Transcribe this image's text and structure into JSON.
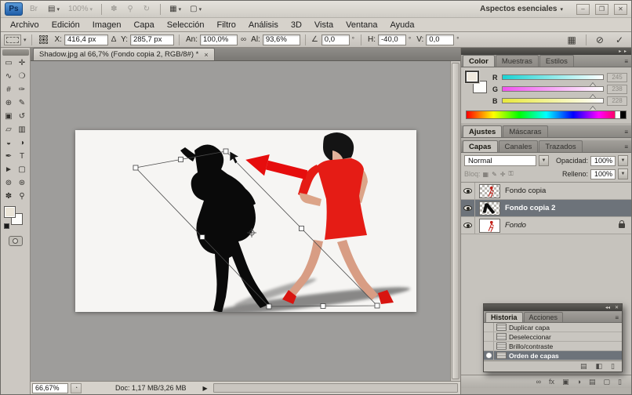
{
  "window": {
    "logo": "Ps",
    "workspace": "Aspectos esenciales",
    "workspace_dd": "▾",
    "controls": {
      "minimize": "–",
      "restore": "❐",
      "close": "✕"
    }
  },
  "titlebar": {
    "group1": [
      {
        "name": "launch-bridge-icon",
        "glyph": "Br",
        "dd": "",
        "disabled": true
      },
      {
        "name": "view-extras-icon",
        "glyph": "▤",
        "dd": "▾"
      },
      {
        "name": "zoom-level-dropdown",
        "glyph": "100%",
        "dd": "▾",
        "disabled": true
      }
    ],
    "group2": [
      {
        "name": "hand-tool-icon",
        "glyph": "✽",
        "dd": "",
        "disabled": true
      },
      {
        "name": "zoom-tool-icon",
        "glyph": "⚲",
        "dd": "",
        "disabled": true
      },
      {
        "name": "rotate-view-icon",
        "glyph": "↻",
        "dd": "",
        "disabled": true
      }
    ],
    "group3": [
      {
        "name": "arrange-documents-icon",
        "glyph": "▦",
        "dd": "▾"
      },
      {
        "name": "screen-mode-icon",
        "glyph": "▢",
        "dd": "▾"
      }
    ]
  },
  "menubar": {
    "items": [
      "Archivo",
      "Edición",
      "Imagen",
      "Capa",
      "Selección",
      "Filtro",
      "Análisis",
      "3D",
      "Vista",
      "Ventana",
      "Ayuda"
    ]
  },
  "options": {
    "x_label": "X:",
    "x_value": "416,4 px",
    "delta_icon": "∆",
    "y_label": "Y:",
    "y_value": "285,7 px",
    "w_label": "An:",
    "w_value": "100,0%",
    "link_icon": "∞",
    "h_label": "Al:",
    "h_value": "93,6%",
    "angle_icon": "∠",
    "angle_value": "0,0",
    "hskew_label": "H:",
    "hskew_value": "-40,0",
    "vskew_label": "V:",
    "vskew_value": "0,0",
    "degree": "°",
    "warp_icon": "▦",
    "cancel_icon": "⊘",
    "commit_icon": "✓"
  },
  "toolbox": {
    "tools": [
      {
        "name": "tool-rectangular-marquee",
        "glyph": "▭"
      },
      {
        "name": "tool-move",
        "glyph": "✛"
      },
      {
        "name": "tool-lasso",
        "glyph": "∿"
      },
      {
        "name": "tool-quick-selection",
        "glyph": "❍"
      },
      {
        "name": "tool-crop",
        "glyph": "#"
      },
      {
        "name": "tool-eyedropper",
        "glyph": "✑"
      },
      {
        "name": "tool-healing-brush",
        "glyph": "⊕"
      },
      {
        "name": "tool-brush",
        "glyph": "✎"
      },
      {
        "name": "tool-clone-stamp",
        "glyph": "▣"
      },
      {
        "name": "tool-history-brush",
        "glyph": "↺"
      },
      {
        "name": "tool-eraser",
        "glyph": "▱"
      },
      {
        "name": "tool-gradient",
        "glyph": "▥"
      },
      {
        "name": "tool-blur",
        "glyph": "◒"
      },
      {
        "name": "tool-dodge",
        "glyph": "◑"
      },
      {
        "name": "tool-pen",
        "glyph": "✒"
      },
      {
        "name": "tool-type",
        "glyph": "T"
      },
      {
        "name": "tool-path-selection",
        "glyph": "►"
      },
      {
        "name": "tool-shape",
        "glyph": "▢"
      },
      {
        "name": "tool-3d-rotate",
        "glyph": "⊚"
      },
      {
        "name": "tool-3d-orbit",
        "glyph": "⊛"
      },
      {
        "name": "tool-hand",
        "glyph": "✽"
      },
      {
        "name": "tool-zoom",
        "glyph": "⚲"
      }
    ]
  },
  "document": {
    "tab_title": "Shadow.jpg al 66,7% (Fondo copia 2, RGB/8#) *",
    "close_glyph": "×"
  },
  "statusbar": {
    "zoom": "66,67%",
    "mini_icon": "◔",
    "doc_info": "Doc: 1,17 MB/3,26 MB",
    "arrow": "▶"
  },
  "dock": {
    "collapse": "▸ ▸",
    "panel_menu": "≡"
  },
  "color_panel": {
    "tabs": [
      "Color",
      "Muestras",
      "Estilos"
    ],
    "channels": [
      {
        "label": "R",
        "value": "245"
      },
      {
        "label": "G",
        "value": "238"
      },
      {
        "label": "B",
        "value": "228"
      }
    ]
  },
  "adjust_bar": {
    "tabs": [
      "Ajustes",
      "Máscaras"
    ]
  },
  "layers_panel": {
    "tabs": [
      "Capas",
      "Canales",
      "Trazados"
    ],
    "blend_mode": "Normal",
    "opacity_label": "Opacidad:",
    "opacity_value": "100%",
    "lock_label": "Bloq:",
    "lock_icons": [
      {
        "name": "lock-transparency-icon",
        "glyph": "▦"
      },
      {
        "name": "lock-pixels-icon",
        "glyph": "✎"
      },
      {
        "name": "lock-position-icon",
        "glyph": "✛"
      },
      {
        "name": "lock-all-icon",
        "glyph": "⚿"
      }
    ],
    "fill_label": "Relleno:",
    "fill_value": "100%",
    "layers": [
      {
        "name": "Fondo copia"
      },
      {
        "name": "Fondo copia 2"
      },
      {
        "name": "Fondo"
      }
    ],
    "footer_icons": [
      {
        "name": "link-layers-icon",
        "glyph": "∞"
      },
      {
        "name": "layer-style-icon",
        "glyph": "fx"
      },
      {
        "name": "add-mask-icon",
        "glyph": "▣"
      },
      {
        "name": "adjustment-layer-icon",
        "glyph": "◑"
      },
      {
        "name": "group-layers-icon",
        "glyph": "▤"
      },
      {
        "name": "new-layer-icon",
        "glyph": "▢"
      },
      {
        "name": "delete-layer-icon",
        "glyph": "▯"
      }
    ]
  },
  "history_panel": {
    "tabs": [
      "Historia",
      "Acciones"
    ],
    "header_icons": [
      {
        "name": "collapse-icons",
        "glyph": "◂◂"
      },
      {
        "name": "close-icon",
        "glyph": "✕"
      }
    ],
    "items": [
      {
        "label": "Duplicar capa"
      },
      {
        "label": "Deseleccionar"
      },
      {
        "label": "Brillo/contraste"
      },
      {
        "label": "Orden de capas",
        "selected": true
      }
    ],
    "footer_icons": [
      {
        "name": "new-document-from-state-icon",
        "glyph": "▤"
      },
      {
        "name": "new-snapshot-icon",
        "glyph": "◧"
      },
      {
        "name": "delete-state-icon",
        "glyph": "▯"
      }
    ]
  },
  "colors": {
    "accent_red": "#e51c15",
    "selected_row": "#6d737a",
    "canvas_gray": "#9e9d9b",
    "chrome_gray": "#d6d2cb"
  }
}
